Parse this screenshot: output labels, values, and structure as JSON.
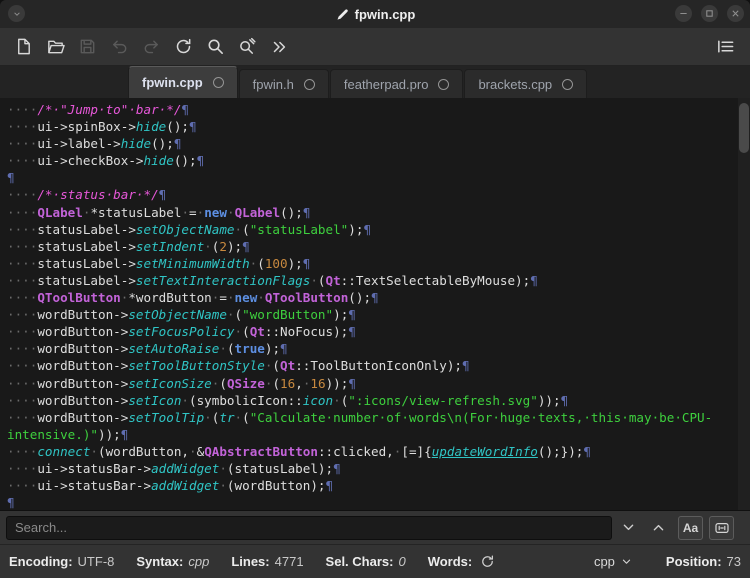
{
  "window": {
    "title": "fpwin.cpp"
  },
  "toolbar": {
    "icons": [
      "new-document",
      "open-file",
      "save",
      "undo",
      "redo",
      "reload",
      "search",
      "find-replace",
      "more",
      "menu"
    ]
  },
  "tabs": [
    {
      "label": "fpwin.cpp",
      "active": true
    },
    {
      "label": "fpwin.h",
      "active": false
    },
    {
      "label": "featherpad.pro",
      "active": false
    },
    {
      "label": "brackets.cpp",
      "active": false
    }
  ],
  "editor": {
    "lines": [
      [
        [
          "ws",
          "····"
        ],
        [
          "c",
          "/*·\"Jump·to\"·bar·*/"
        ],
        [
          "p",
          "¶"
        ]
      ],
      [
        [
          "ws",
          "····"
        ],
        [
          "pl",
          "ui->spinBox->"
        ],
        [
          "fn",
          "hide"
        ],
        [
          "pl",
          "();"
        ],
        [
          "p",
          "¶"
        ]
      ],
      [
        [
          "ws",
          "····"
        ],
        [
          "pl",
          "ui->label->"
        ],
        [
          "fn",
          "hide"
        ],
        [
          "pl",
          "();"
        ],
        [
          "p",
          "¶"
        ]
      ],
      [
        [
          "ws",
          "····"
        ],
        [
          "pl",
          "ui->checkBox->"
        ],
        [
          "fn",
          "hide"
        ],
        [
          "pl",
          "();"
        ],
        [
          "p",
          "¶"
        ]
      ],
      [
        [
          "p",
          "¶"
        ]
      ],
      [
        [
          "ws",
          "····"
        ],
        [
          "c",
          "/*·status·bar·*/"
        ],
        [
          "p",
          "¶"
        ]
      ],
      [
        [
          "ws",
          "····"
        ],
        [
          "cl",
          "QLabel"
        ],
        [
          "ws",
          "·"
        ],
        [
          "pl",
          "*statusLabel"
        ],
        [
          "ws",
          "·"
        ],
        [
          "pl",
          "="
        ],
        [
          "ws",
          "·"
        ],
        [
          "kw",
          "new"
        ],
        [
          "ws",
          "·"
        ],
        [
          "cl",
          "QLabel"
        ],
        [
          "pl",
          "();"
        ],
        [
          "p",
          "¶"
        ]
      ],
      [
        [
          "ws",
          "····"
        ],
        [
          "pl",
          "statusLabel->"
        ],
        [
          "fn",
          "setObjectName"
        ],
        [
          "ws",
          "·"
        ],
        [
          "pl",
          "("
        ],
        [
          "st",
          "\"statusLabel\""
        ],
        [
          "pl",
          ");"
        ],
        [
          "p",
          "¶"
        ]
      ],
      [
        [
          "ws",
          "····"
        ],
        [
          "pl",
          "statusLabel->"
        ],
        [
          "fn",
          "setIndent"
        ],
        [
          "ws",
          "·"
        ],
        [
          "pl",
          "("
        ],
        [
          "nu",
          "2"
        ],
        [
          "pl",
          ");"
        ],
        [
          "p",
          "¶"
        ]
      ],
      [
        [
          "ws",
          "····"
        ],
        [
          "pl",
          "statusLabel->"
        ],
        [
          "fn",
          "setMinimumWidth"
        ],
        [
          "ws",
          "·"
        ],
        [
          "pl",
          "("
        ],
        [
          "nu",
          "100"
        ],
        [
          "pl",
          ");"
        ],
        [
          "p",
          "¶"
        ]
      ],
      [
        [
          "ws",
          "····"
        ],
        [
          "pl",
          "statusLabel->"
        ],
        [
          "fn",
          "setTextInteractionFlags"
        ],
        [
          "ws",
          "·"
        ],
        [
          "pl",
          "("
        ],
        [
          "cl",
          "Qt"
        ],
        [
          "pl",
          "::TextSelectableByMouse);"
        ],
        [
          "p",
          "¶"
        ]
      ],
      [
        [
          "ws",
          "····"
        ],
        [
          "cl",
          "QToolButton"
        ],
        [
          "ws",
          "·"
        ],
        [
          "pl",
          "*wordButton"
        ],
        [
          "ws",
          "·"
        ],
        [
          "pl",
          "="
        ],
        [
          "ws",
          "·"
        ],
        [
          "kw",
          "new"
        ],
        [
          "ws",
          "·"
        ],
        [
          "cl",
          "QToolButton"
        ],
        [
          "pl",
          "();"
        ],
        [
          "p",
          "¶"
        ]
      ],
      [
        [
          "ws",
          "····"
        ],
        [
          "pl",
          "wordButton->"
        ],
        [
          "fn",
          "setObjectName"
        ],
        [
          "ws",
          "·"
        ],
        [
          "pl",
          "("
        ],
        [
          "st",
          "\"wordButton\""
        ],
        [
          "pl",
          ");"
        ],
        [
          "p",
          "¶"
        ]
      ],
      [
        [
          "ws",
          "····"
        ],
        [
          "pl",
          "wordButton->"
        ],
        [
          "fn",
          "setFocusPolicy"
        ],
        [
          "ws",
          "·"
        ],
        [
          "pl",
          "("
        ],
        [
          "cl",
          "Qt"
        ],
        [
          "pl",
          "::NoFocus);"
        ],
        [
          "p",
          "¶"
        ]
      ],
      [
        [
          "ws",
          "····"
        ],
        [
          "pl",
          "wordButton->"
        ],
        [
          "fn",
          "setAutoRaise"
        ],
        [
          "ws",
          "·"
        ],
        [
          "pl",
          "("
        ],
        [
          "kw",
          "true"
        ],
        [
          "pl",
          ");"
        ],
        [
          "p",
          "¶"
        ]
      ],
      [
        [
          "ws",
          "····"
        ],
        [
          "pl",
          "wordButton->"
        ],
        [
          "fn",
          "setToolButtonStyle"
        ],
        [
          "ws",
          "·"
        ],
        [
          "pl",
          "("
        ],
        [
          "cl",
          "Qt"
        ],
        [
          "pl",
          "::ToolButtonIconOnly);"
        ],
        [
          "p",
          "¶"
        ]
      ],
      [
        [
          "ws",
          "····"
        ],
        [
          "pl",
          "wordButton->"
        ],
        [
          "fn",
          "setIconSize"
        ],
        [
          "ws",
          "·"
        ],
        [
          "pl",
          "("
        ],
        [
          "cl",
          "QSize"
        ],
        [
          "ws",
          "·"
        ],
        [
          "pl",
          "("
        ],
        [
          "nu",
          "16"
        ],
        [
          "pl",
          ","
        ],
        [
          "ws",
          "·"
        ],
        [
          "nu",
          "16"
        ],
        [
          "pl",
          "));"
        ],
        [
          "p",
          "¶"
        ]
      ],
      [
        [
          "ws",
          "····"
        ],
        [
          "pl",
          "wordButton->"
        ],
        [
          "fn",
          "setIcon"
        ],
        [
          "ws",
          "·"
        ],
        [
          "pl",
          "(symbolicIcon::"
        ],
        [
          "fn",
          "icon"
        ],
        [
          "ws",
          "·"
        ],
        [
          "pl",
          "("
        ],
        [
          "st",
          "\":icons/view-refresh.svg\""
        ],
        [
          "pl",
          "));"
        ],
        [
          "p",
          "¶"
        ]
      ],
      [
        [
          "ws",
          "····"
        ],
        [
          "pl",
          "wordButton->"
        ],
        [
          "fn",
          "setToolTip"
        ],
        [
          "ws",
          "·"
        ],
        [
          "pl",
          "("
        ],
        [
          "fn",
          "tr"
        ],
        [
          "ws",
          "·"
        ],
        [
          "pl",
          "("
        ],
        [
          "st",
          "\"Calculate·number·of·words\\n(For·huge·texts,·this·may·be·CPU-"
        ]
      ],
      [
        [
          "st",
          "intensive.)\""
        ],
        [
          "pl",
          "));"
        ],
        [
          "p",
          "¶"
        ]
      ],
      [
        [
          "ws",
          "····"
        ],
        [
          "fn",
          "connect"
        ],
        [
          "ws",
          "·"
        ],
        [
          "pl",
          "(wordButton,"
        ],
        [
          "ws",
          "·"
        ],
        [
          "pl",
          "&"
        ],
        [
          "cl",
          "QAbstractButton"
        ],
        [
          "pl",
          "::clicked,"
        ],
        [
          "ws",
          "·"
        ],
        [
          "pl",
          "[=]{"
        ],
        [
          "lk",
          "updateWordInfo"
        ],
        [
          "pl",
          "();});"
        ],
        [
          "p",
          "¶"
        ]
      ],
      [
        [
          "ws",
          "····"
        ],
        [
          "pl",
          "ui->statusBar->"
        ],
        [
          "fn",
          "addWidget"
        ],
        [
          "ws",
          "·"
        ],
        [
          "pl",
          "(statusLabel);"
        ],
        [
          "p",
          "¶"
        ]
      ],
      [
        [
          "ws",
          "····"
        ],
        [
          "pl",
          "ui->statusBar->"
        ],
        [
          "fn",
          "addWidget"
        ],
        [
          "ws",
          "·"
        ],
        [
          "pl",
          "(wordButton);"
        ],
        [
          "p",
          "¶"
        ]
      ],
      [
        [
          "p",
          "¶"
        ]
      ]
    ]
  },
  "search": {
    "placeholder": "Search...",
    "match_case_label": "Aa"
  },
  "statusbar": {
    "encoding_label": "Encoding:",
    "encoding": "UTF-8",
    "syntax_label": "Syntax:",
    "syntax": "cpp",
    "lines_label": "Lines:",
    "lines": "4771",
    "sel_label": "Sel. Chars:",
    "sel": "0",
    "words_label": "Words:",
    "lang": "cpp",
    "position_label": "Position:",
    "position": "73"
  }
}
